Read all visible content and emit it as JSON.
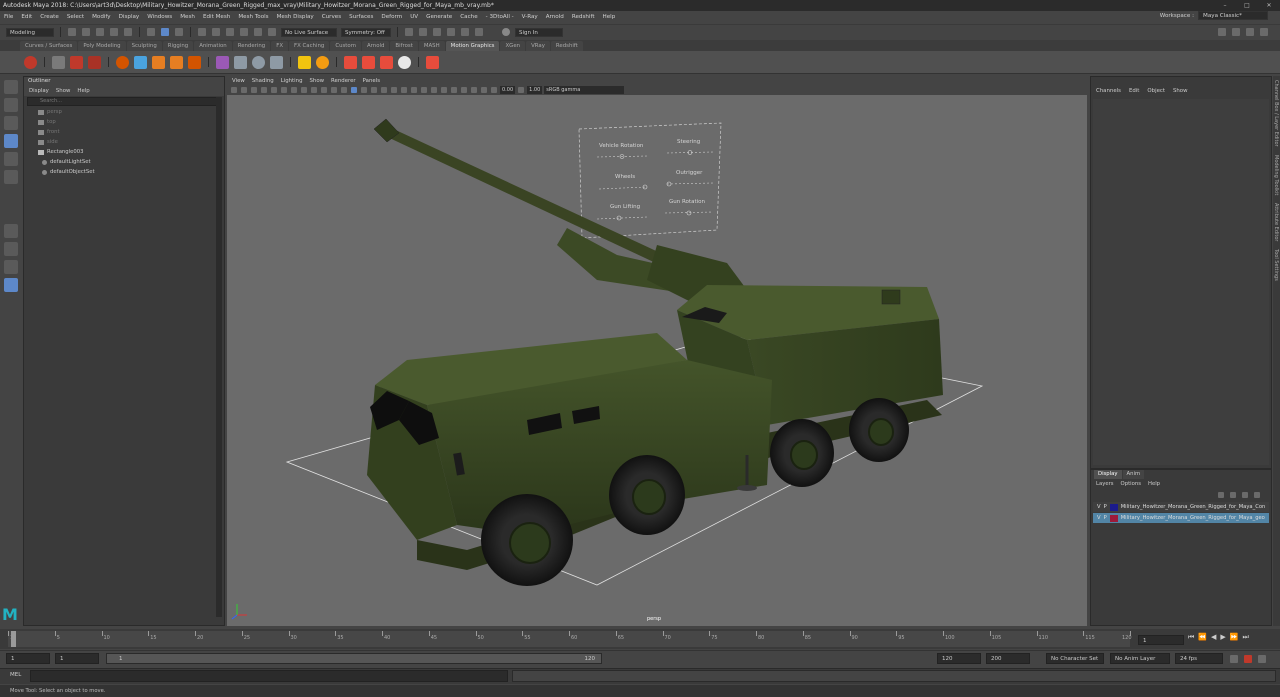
{
  "window": {
    "title": "Autodesk Maya 2018: C:\\Users\\art3d\\Desktop\\Military_Howitzer_Morana_Green_Rigged_max_vray\\Military_Howitzer_Morana_Green_Rigged_for_Maya_mb_vray.mb*",
    "controls": [
      "–",
      "□",
      "✕"
    ]
  },
  "menubar": {
    "items": [
      "File",
      "Edit",
      "Create",
      "Select",
      "Modify",
      "Display",
      "Windows",
      "Mesh",
      "Edit Mesh",
      "Mesh Tools",
      "Mesh Display",
      "Curves",
      "Surfaces",
      "Deform",
      "UV",
      "Generate",
      "Cache",
      "- 3DtoAll -",
      "V-Ray",
      "Arnold",
      "Redshift",
      "Help"
    ],
    "workspace_label": "Workspace :",
    "workspace_value": "Maya Classic*"
  },
  "statusline": {
    "mode": "Modeling",
    "live_surface": "No Live Surface",
    "symmetry": "Symmetry: Off",
    "sign_in": "Sign In"
  },
  "shelf": {
    "tabs": [
      "Curves / Surfaces",
      "Poly Modeling",
      "Sculpting",
      "Rigging",
      "Animation",
      "Rendering",
      "FX",
      "FX Caching",
      "Custom",
      "Arnold",
      "Bifrost",
      "MASH",
      "Motion Graphics",
      "XGen",
      "VRay",
      "Redshift"
    ],
    "active_tab": "Motion Graphics"
  },
  "outliner": {
    "title": "Outliner",
    "menu": [
      "Display",
      "Show",
      "Help"
    ],
    "search_placeholder": "Search...",
    "items": [
      {
        "label": "persp",
        "dim": true
      },
      {
        "label": "top",
        "dim": true
      },
      {
        "label": "front",
        "dim": true
      },
      {
        "label": "side",
        "dim": true
      },
      {
        "label": "Rectangle003",
        "dim": false
      },
      {
        "label": "defaultLightSet",
        "dim": false
      },
      {
        "label": "defaultObjectSet",
        "dim": false
      }
    ]
  },
  "viewport": {
    "menu": [
      "View",
      "Shading",
      "Lighting",
      "Show",
      "Renderer",
      "Panels"
    ],
    "exposure": "0.00",
    "gamma": "1.00",
    "color_space": "sRGB gamma",
    "camera_label": "persp",
    "hud_labels": [
      "Vehicle Rotation",
      "Steering",
      "Wheels",
      "Outrigger",
      "Gun Lifting",
      "Gun Rotation"
    ]
  },
  "channelbox": {
    "menu": [
      "Channels",
      "Edit",
      "Object",
      "Show"
    ]
  },
  "layers": {
    "tabs": [
      "Display",
      "Anim"
    ],
    "menu": [
      "Layers",
      "Options",
      "Help"
    ],
    "rows": [
      {
        "v": "V",
        "p": "P",
        "color": "#1b1b8c",
        "name": "Military_Howitzer_Morana_Green_Rigged_for_Maya_Con",
        "selected": false
      },
      {
        "v": "V",
        "p": "P",
        "color": "#9c1a3a",
        "name": "Military_Howitzer_Morana_Green_Rigged_for_Maya_geo",
        "selected": true
      }
    ]
  },
  "sidetabs": [
    "Channel Box / Layer Editor",
    "Modeling Toolkit",
    "Attribute Editor",
    "Tool Settings"
  ],
  "timeline": {
    "ticks": [
      "1",
      "5",
      "10",
      "15",
      "20",
      "25",
      "30",
      "35",
      "40",
      "45",
      "50",
      "55",
      "60",
      "65",
      "70",
      "75",
      "80",
      "85",
      "90",
      "95",
      "100",
      "105",
      "110",
      "115",
      "120"
    ],
    "current_frame": "1",
    "playback_icons": [
      "⏮",
      "⏪",
      "◀",
      "▶",
      "⏩",
      "⏭"
    ]
  },
  "range": {
    "start": "1",
    "playback_start": "1",
    "slider_start": "1",
    "slider_end": "120",
    "playback_end": "120",
    "end": "200",
    "character_set": "No Character Set",
    "anim_layer": "No Anim Layer",
    "fps": "24 fps"
  },
  "commandline": {
    "label": "MEL"
  },
  "helpline": {
    "text": "Move Tool: Select an object to move."
  },
  "colors": {
    "accent": "#5d88c9",
    "vehicle": "#3b4a22",
    "viewport_bg": "#6b6b6b",
    "maya_logo": "#22b3c2"
  }
}
